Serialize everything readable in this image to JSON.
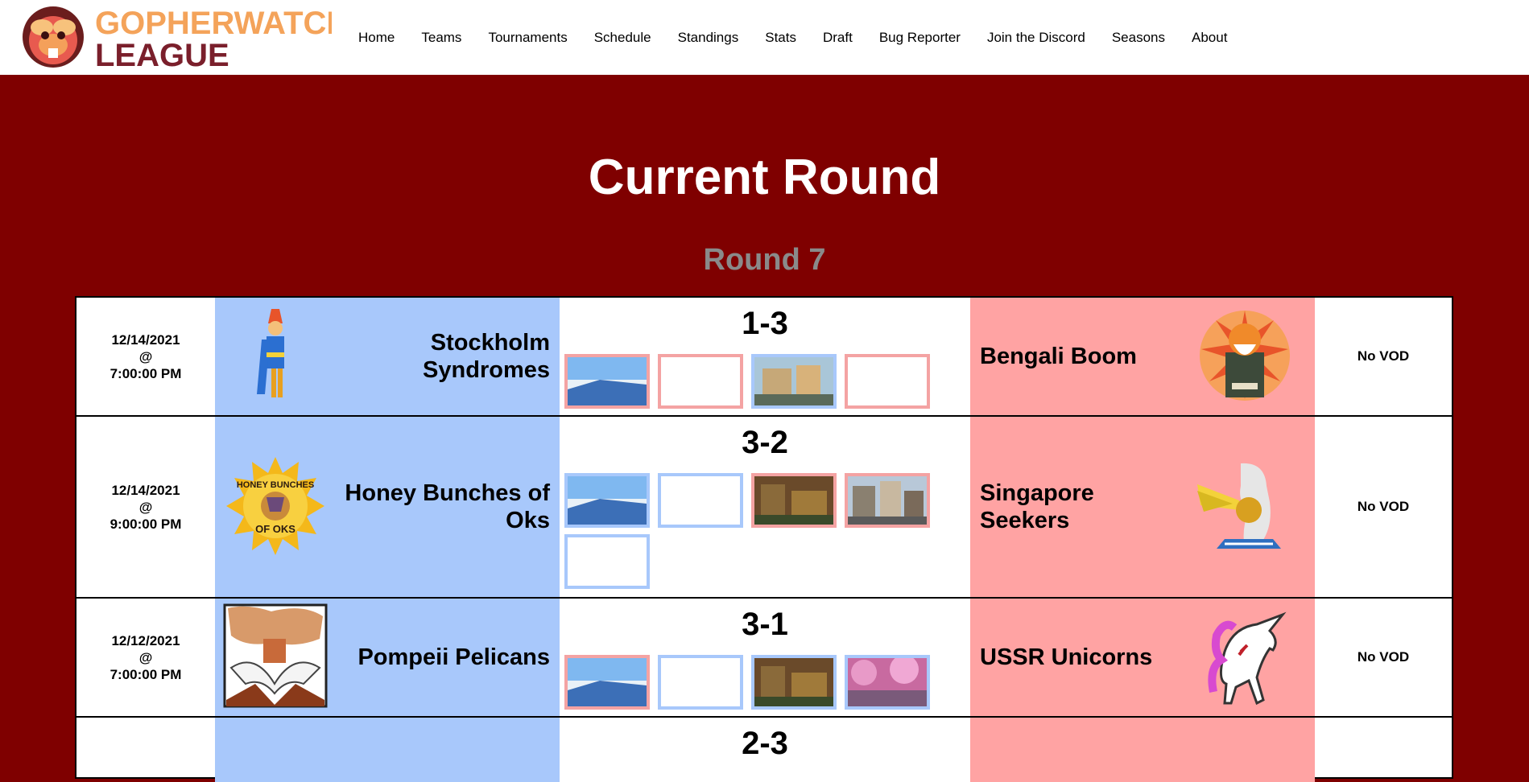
{
  "header": {
    "logo_text_top": "GOPHERWATCH",
    "logo_text_bottom": "LEAGUE",
    "nav": [
      "Home",
      "Teams",
      "Tournaments",
      "Schedule",
      "Standings",
      "Stats",
      "Draft",
      "Bug Reporter",
      "Join the Discord",
      "Seasons",
      "About"
    ]
  },
  "page": {
    "title": "Current Round",
    "subtitle": "Round 7"
  },
  "colors": {
    "background": "#7f0000",
    "home_team": "#a8c8fb",
    "away_team": "#ffa3a3",
    "map_win_home": "#a8c8fb",
    "map_win_away": "#f4a3a3"
  },
  "matches": [
    {
      "date": "12/14/2021",
      "at": "@",
      "time": "7:00:00 PM",
      "home": "Stockholm Syndromes",
      "score": "1-3",
      "away": "Bengali Boom",
      "vod": "No VOD",
      "maps": [
        {
          "winner": "away",
          "type": "beach"
        },
        {
          "winner": "away",
          "type": "empty"
        },
        {
          "winner": "home",
          "type": "town"
        },
        {
          "winner": "away",
          "type": "empty"
        }
      ]
    },
    {
      "date": "12/14/2021",
      "at": "@",
      "time": "9:00:00 PM",
      "home": "Honey Bunches of Oks",
      "score": "3-2",
      "away": "Singapore Seekers",
      "vod": "No VOD",
      "maps": [
        {
          "winner": "home",
          "type": "beach"
        },
        {
          "winner": "home",
          "type": "empty"
        },
        {
          "winner": "away",
          "type": "forest"
        },
        {
          "winner": "away",
          "type": "city"
        },
        {
          "winner": "home",
          "type": "empty"
        }
      ]
    },
    {
      "date": "12/12/2021",
      "at": "@",
      "time": "7:00:00 PM",
      "home": "Pompeii Pelicans",
      "score": "3-1",
      "away": "USSR Unicorns",
      "vod": "No VOD",
      "maps": [
        {
          "winner": "away",
          "type": "beach"
        },
        {
          "winner": "home",
          "type": "empty"
        },
        {
          "winner": "home",
          "type": "forest"
        },
        {
          "winner": "home",
          "type": "blossom"
        }
      ]
    },
    {
      "score": "2-3"
    }
  ]
}
